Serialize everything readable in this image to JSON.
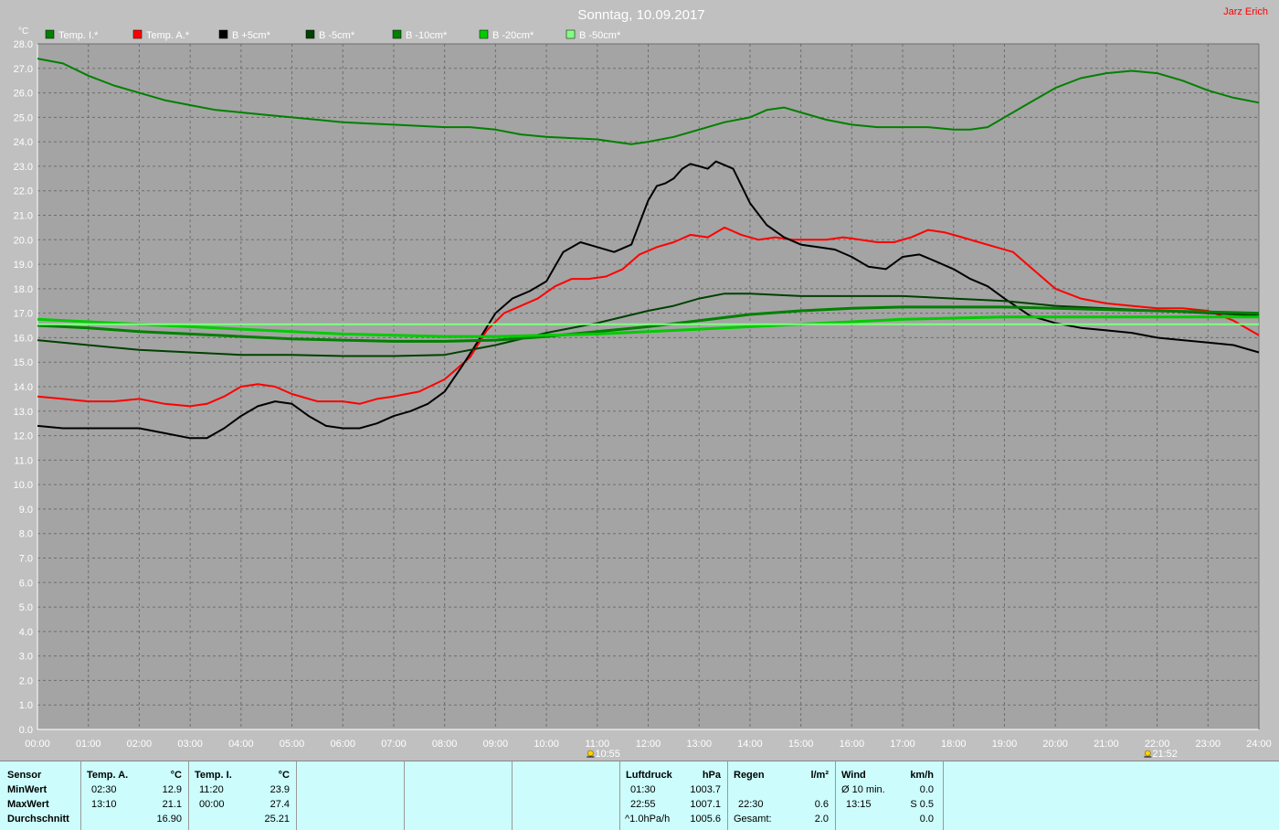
{
  "chart_data": {
    "type": "line",
    "title": "Sonntag, 10.09.2017",
    "author": "Jarz Erich",
    "ylabel": "°C",
    "ylim": [
      0,
      28
    ],
    "yticks": [
      "0.0",
      "1.0",
      "2.0",
      "3.0",
      "4.0",
      "5.0",
      "6.0",
      "7.0",
      "8.0",
      "9.0",
      "10.0",
      "11.0",
      "12.0",
      "13.0",
      "14.0",
      "15.0",
      "16.0",
      "17.0",
      "18.0",
      "19.0",
      "20.0",
      "21.0",
      "22.0",
      "23.0",
      "24.0",
      "25.0",
      "26.0",
      "27.0",
      "28.0"
    ],
    "xlim": [
      0,
      24
    ],
    "xticks": [
      "00:00",
      "01:00",
      "02:00",
      "03:00",
      "04:00",
      "05:00",
      "06:00",
      "07:00",
      "08:00",
      "09:00",
      "10:00",
      "11:00",
      "12:00",
      "13:00",
      "14:00",
      "15:00",
      "16:00",
      "17:00",
      "18:00",
      "19:00",
      "20:00",
      "21:00",
      "22:00",
      "23:00",
      "24:00"
    ],
    "markers": [
      {
        "label": "10:55",
        "x": 10.92
      },
      {
        "label": "21:52",
        "x": 21.87
      }
    ],
    "grid": true,
    "legend_position": "top-left",
    "series": [
      {
        "name": "Temp. I.*",
        "color": "#008000",
        "width": 2,
        "x": [
          0,
          0.5,
          1,
          1.5,
          2,
          2.5,
          3,
          3.5,
          4,
          4.5,
          5,
          5.5,
          6,
          6.5,
          7,
          7.5,
          8,
          8.5,
          9,
          9.5,
          10,
          10.5,
          11,
          11.33,
          11.67,
          12,
          12.5,
          13,
          13.5,
          14,
          14.33,
          14.67,
          15,
          15.5,
          16,
          16.5,
          17,
          17.5,
          18,
          18.33,
          18.67,
          19,
          19.5,
          20,
          20.5,
          21,
          21.5,
          22,
          22.5,
          23,
          23.5,
          24
        ],
        "y": [
          27.4,
          27.2,
          26.7,
          26.3,
          26.0,
          25.7,
          25.5,
          25.3,
          25.2,
          25.1,
          25.0,
          24.9,
          24.8,
          24.75,
          24.7,
          24.65,
          24.6,
          24.6,
          24.5,
          24.3,
          24.2,
          24.15,
          24.1,
          24.0,
          23.9,
          24.0,
          24.2,
          24.5,
          24.8,
          25.0,
          25.3,
          25.4,
          25.2,
          24.9,
          24.7,
          24.6,
          24.6,
          24.6,
          24.5,
          24.5,
          24.6,
          25.0,
          25.6,
          26.2,
          26.6,
          26.8,
          26.9,
          26.8,
          26.5,
          26.1,
          25.8,
          25.6
        ]
      },
      {
        "name": "Temp. A.*",
        "color": "#ff0000",
        "width": 2,
        "x": [
          0,
          0.5,
          1,
          1.5,
          2,
          2.5,
          3,
          3.33,
          3.67,
          4,
          4.33,
          4.67,
          5,
          5.5,
          6,
          6.33,
          6.67,
          7,
          7.5,
          8,
          8.5,
          8.83,
          9.17,
          9.5,
          9.83,
          10.17,
          10.5,
          10.83,
          11.17,
          11.5,
          11.83,
          12.17,
          12.5,
          12.83,
          13.17,
          13.5,
          13.83,
          14.17,
          14.5,
          14.83,
          15.17,
          15.5,
          15.83,
          16.17,
          16.5,
          16.83,
          17.17,
          17.5,
          17.83,
          18.17,
          18.5,
          18.83,
          19.17,
          19.5,
          20,
          20.5,
          21,
          21.5,
          22,
          22.5,
          23,
          23.5,
          24
        ],
        "y": [
          13.6,
          13.5,
          13.4,
          13.4,
          13.5,
          13.3,
          13.2,
          13.3,
          13.6,
          14.0,
          14.1,
          14.0,
          13.7,
          13.4,
          13.4,
          13.3,
          13.5,
          13.6,
          13.8,
          14.3,
          15.2,
          16.3,
          17.0,
          17.3,
          17.6,
          18.1,
          18.4,
          18.4,
          18.5,
          18.8,
          19.4,
          19.7,
          19.9,
          20.2,
          20.1,
          20.5,
          20.2,
          20.0,
          20.1,
          20.0,
          20.0,
          20.0,
          20.1,
          20.0,
          19.9,
          19.9,
          20.1,
          20.4,
          20.3,
          20.1,
          19.9,
          19.7,
          19.5,
          18.9,
          18.0,
          17.6,
          17.4,
          17.3,
          17.2,
          17.2,
          17.1,
          16.7,
          16.1
        ]
      },
      {
        "name": "B +5cm*",
        "color": "#000000",
        "width": 2,
        "x": [
          0,
          0.5,
          1,
          1.5,
          2,
          2.5,
          3,
          3.33,
          3.67,
          4,
          4.33,
          4.67,
          5,
          5.33,
          5.67,
          6,
          6.33,
          6.67,
          7,
          7.33,
          7.67,
          8,
          8.33,
          8.67,
          9,
          9.33,
          9.67,
          10,
          10.33,
          10.67,
          11,
          11.33,
          11.67,
          12,
          12.17,
          12.33,
          12.5,
          12.67,
          12.83,
          13,
          13.17,
          13.33,
          13.67,
          14,
          14.33,
          14.67,
          15,
          15.33,
          15.67,
          16,
          16.33,
          16.67,
          17,
          17.33,
          17.67,
          18,
          18.33,
          18.67,
          19,
          19.5,
          20,
          20.5,
          21,
          21.5,
          22,
          22.5,
          23,
          23.5,
          24
        ],
        "y": [
          12.4,
          12.3,
          12.3,
          12.3,
          12.3,
          12.1,
          11.9,
          11.9,
          12.3,
          12.8,
          13.2,
          13.4,
          13.3,
          12.8,
          12.4,
          12.3,
          12.3,
          12.5,
          12.8,
          13.0,
          13.3,
          13.8,
          14.8,
          15.9,
          17.0,
          17.6,
          17.9,
          18.3,
          19.5,
          19.9,
          19.7,
          19.5,
          19.8,
          21.6,
          22.2,
          22.3,
          22.5,
          22.9,
          23.1,
          23.0,
          22.9,
          23.2,
          22.9,
          21.5,
          20.6,
          20.1,
          19.8,
          19.7,
          19.6,
          19.3,
          18.9,
          18.8,
          19.3,
          19.4,
          19.1,
          18.8,
          18.4,
          18.1,
          17.6,
          16.9,
          16.6,
          16.4,
          16.3,
          16.2,
          16.0,
          15.9,
          15.8,
          15.7,
          15.4
        ]
      },
      {
        "name": "B -5cm*",
        "color": "#004000",
        "width": 2,
        "x": [
          0,
          1,
          2,
          3,
          4,
          5,
          6,
          7,
          8,
          9,
          10,
          11,
          12,
          12.5,
          13,
          13.5,
          14,
          15,
          16,
          17,
          18,
          19,
          20,
          21,
          22,
          23,
          24
        ],
        "y": [
          15.9,
          15.7,
          15.5,
          15.4,
          15.3,
          15.3,
          15.25,
          15.25,
          15.3,
          15.7,
          16.2,
          16.6,
          17.1,
          17.3,
          17.6,
          17.8,
          17.8,
          17.7,
          17.7,
          17.7,
          17.6,
          17.5,
          17.3,
          17.2,
          17.1,
          17.0,
          16.9
        ]
      },
      {
        "name": "B -10cm*",
        "color": "#008000",
        "width": 3,
        "x": [
          0,
          1,
          2,
          3,
          4,
          5,
          6,
          7,
          8,
          9,
          10,
          11,
          12,
          13,
          14,
          15,
          16,
          17,
          18,
          19,
          20,
          21,
          22,
          23,
          24
        ],
        "y": [
          16.5,
          16.4,
          16.25,
          16.15,
          16.05,
          15.95,
          15.9,
          15.85,
          15.85,
          15.9,
          16.05,
          16.25,
          16.45,
          16.7,
          16.95,
          17.1,
          17.2,
          17.25,
          17.25,
          17.25,
          17.2,
          17.15,
          17.1,
          17.05,
          17.0
        ]
      },
      {
        "name": "B -20cm*",
        "color": "#00cc00",
        "width": 3,
        "x": [
          0,
          1,
          2,
          3,
          4,
          5,
          6,
          7,
          8,
          9,
          10,
          11,
          12,
          13,
          14,
          15,
          16,
          17,
          18,
          19,
          20,
          21,
          22,
          23,
          24
        ],
        "y": [
          16.75,
          16.65,
          16.55,
          16.45,
          16.35,
          16.25,
          16.15,
          16.1,
          16.05,
          16.05,
          16.1,
          16.15,
          16.25,
          16.35,
          16.45,
          16.55,
          16.65,
          16.75,
          16.8,
          16.85,
          16.85,
          16.85,
          16.85,
          16.85,
          16.85
        ]
      },
      {
        "name": "B -50cm*",
        "color": "#80ff80",
        "width": 2,
        "x": [
          0,
          3,
          6,
          9,
          12,
          15,
          18,
          21,
          24
        ],
        "y": [
          16.55,
          16.55,
          16.55,
          16.55,
          16.55,
          16.55,
          16.55,
          16.55,
          16.55
        ]
      }
    ]
  },
  "table": {
    "sensor": {
      "header": "Sensor",
      "rows": [
        "MinWert",
        "MaxWert",
        "Durchschnitt"
      ]
    },
    "temp_a": {
      "header": "Temp. A.",
      "unit": "°C",
      "min_time": "02:30",
      "min_val": "12.9",
      "max_time": "13:10",
      "max_val": "21.1",
      "avg": "16.90"
    },
    "temp_i": {
      "header": "Temp. I.",
      "unit": "°C",
      "min_time": "11:20",
      "min_val": "23.9",
      "max_time": "00:00",
      "max_val": "27.4",
      "avg": "25.21"
    },
    "luftdruck": {
      "header": "Luftdruck",
      "unit": "hPa",
      "min_time": "01:30",
      "min_val": "1003.7",
      "max_time": "22:55",
      "max_val": "1007.1",
      "trend": "^1.0hPa/h",
      "avg": "1005.6"
    },
    "regen": {
      "header": "Regen",
      "unit": "l/m²",
      "row2_time": "22:30",
      "row2_val": "0.6",
      "row3_label": "Gesamt:",
      "row3_val": "2.0"
    },
    "wind": {
      "header": "Wind",
      "unit": "km/h",
      "row1_label": "Ø 10 min.",
      "row1_val": "0.0",
      "row2_time": "13:15",
      "row2_val": "S 0.5",
      "row3_val": "0.0"
    }
  }
}
